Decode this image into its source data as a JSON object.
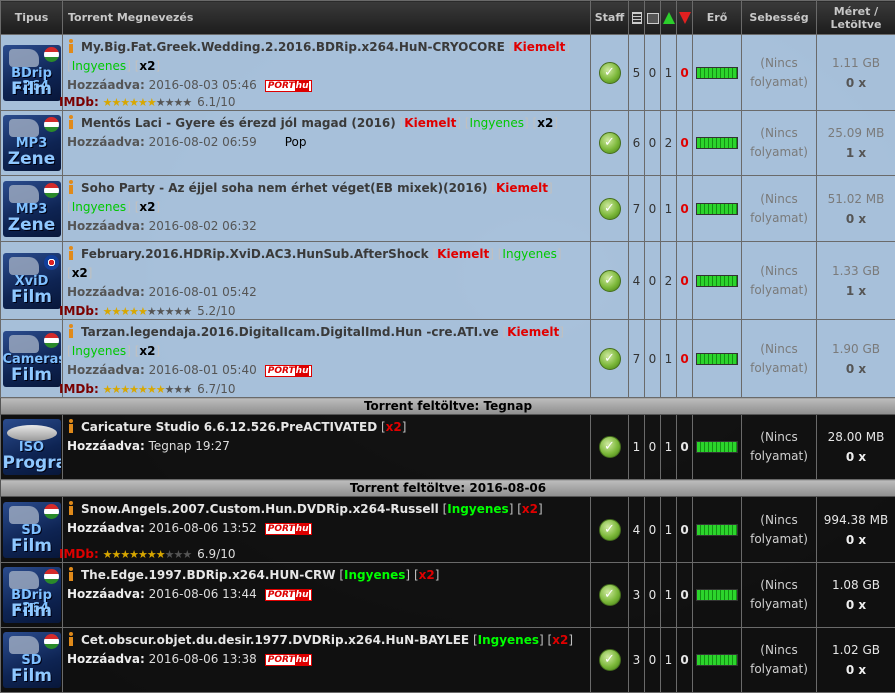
{
  "header": {
    "type": "Tipus",
    "name": "Torrent Megnevezés",
    "staff": "Staff",
    "power": "Erő",
    "speed": "Sebesség",
    "size_line1": "Méret /",
    "size_line2": "Letöltve"
  },
  "labels": {
    "added": "Hozzáadva:",
    "imdb": "IMDb:",
    "featured": "Kiemelt",
    "free": "Ingyenes",
    "x2": "x2",
    "no_progress_1": "(Nincs",
    "no_progress_2": "folyamat)",
    "port": "PORT",
    "port_hu": "hu"
  },
  "separators": {
    "yesterday": "Torrent feltöltve: Tegnap",
    "date_0806": "Torrent feltöltve: 2016-08-06"
  },
  "rows": [
    {
      "cat1": "BDrip x264",
      "cat2": "Film",
      "flag": "hu",
      "title": "My.Big.Fat.Greek.Wedding.2.2016.BDRip.x264.HuN-CRYOCORE",
      "added": "2016-08-03 05:46",
      "imdb": "6.1/10",
      "imdb_rating": 6.1,
      "staff": "✓",
      "n1": "5",
      "n2": "0",
      "n3": "1",
      "n4": "0",
      "size": "1.11 GB",
      "downloaded": "0 x"
    },
    {
      "cat1": "MP3",
      "cat2": "Zene",
      "flag": "hu",
      "title": "Mentős Laci - Gyere és érezd jól magad (2016)",
      "added": "2016-08-02 06:59",
      "genre": "Pop",
      "staff": "✓",
      "n1": "6",
      "n2": "0",
      "n3": "2",
      "n4": "0",
      "size": "25.09 MB",
      "downloaded": "1 x"
    },
    {
      "cat1": "MP3",
      "cat2": "Zene",
      "flag": "hu",
      "title": "Soho Party - Az éjjel soha nem érhet véget(EB mixek)(2016)",
      "added": "2016-08-02 06:32",
      "staff": "✓",
      "n1": "7",
      "n2": "0",
      "n3": "1",
      "n4": "0",
      "size": "51.02 MB",
      "downloaded": "0 x"
    },
    {
      "cat1": "XviD",
      "cat2": "Film",
      "flag": "uk",
      "title": "February.2016.HDRip.XviD.AC3.HunSub.AfterShock",
      "added": "2016-08-01 05:42",
      "imdb": "5.2/10",
      "imdb_rating": 5.2,
      "staff": "✓",
      "n1": "4",
      "n2": "0",
      "n3": "2",
      "n4": "0",
      "size": "1.33 GB",
      "downloaded": "1 x"
    },
    {
      "cat1": "Cameras",
      "cat2": "Film",
      "flag": "hu",
      "title": "Tarzan.legendaja.2016.DigitalIcam.DigitalImd.Hun -cre.ATI.ve",
      "added": "2016-08-01 05:40",
      "imdb": "6.7/10",
      "imdb_rating": 6.7,
      "staff": "✓",
      "n1": "7",
      "n2": "0",
      "n3": "1",
      "n4": "0",
      "size": "1.90 GB",
      "downloaded": "0 x"
    },
    {
      "cat1": "ISO",
      "cat2": "Program",
      "flag": "",
      "title": "Caricature Studio 6.6.12.526.PreACTIVATED",
      "added": "Tegnap 19:27",
      "staff": "✓",
      "n1": "1",
      "n2": "0",
      "n3": "1",
      "n4": "0",
      "size": "28.00 MB",
      "downloaded": "0 x"
    },
    {
      "cat1": "SD",
      "cat2": "Film",
      "flag": "hu",
      "title": "Snow.Angels.2007.Custom.Hun.DVDRip.x264-Russell",
      "added": "2016-08-06 13:52",
      "imdb": "6.9/10",
      "imdb_rating": 6.9,
      "staff": "✓",
      "n1": "4",
      "n2": "0",
      "n3": "1",
      "n4": "0",
      "size": "994.38 MB",
      "downloaded": "0 x"
    },
    {
      "cat1": "BDrip x264",
      "cat2": "Film",
      "flag": "hu",
      "title": "The.Edge.1997.BDRip.x264.HUN-CRW",
      "added": "2016-08-06 13:44",
      "staff": "✓",
      "n1": "3",
      "n2": "0",
      "n3": "1",
      "n4": "0",
      "size": "1.08 GB",
      "downloaded": "0 x"
    },
    {
      "cat1": "SD",
      "cat2": "Film",
      "flag": "hu",
      "title": "Cet.obscur.objet.du.desir.1977.DVDRip.x264.HuN-BAYLEE",
      "added": "2016-08-06 13:38",
      "staff": "✓",
      "n1": "3",
      "n2": "0",
      "n3": "1",
      "n4": "0",
      "size": "1.02 GB",
      "downloaded": "0 x"
    }
  ]
}
